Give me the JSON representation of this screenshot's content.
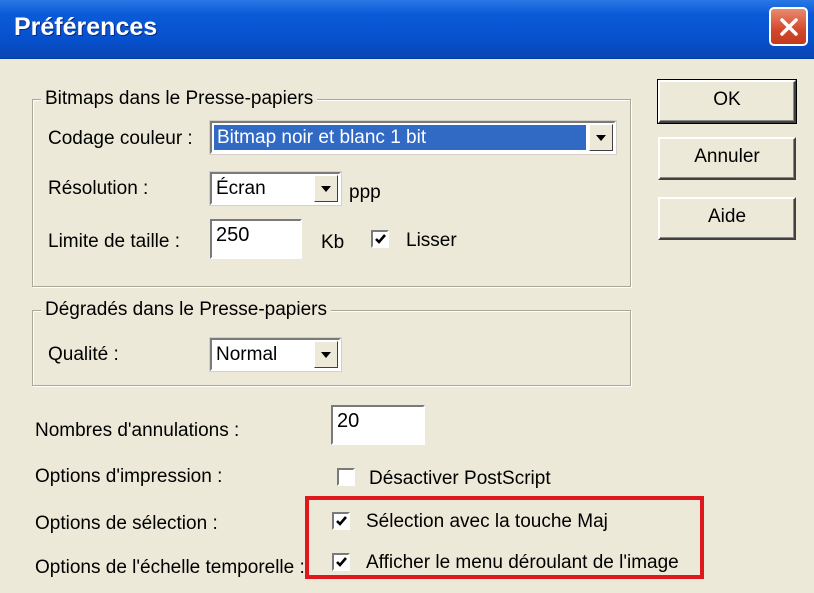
{
  "window": {
    "title": "Préférences"
  },
  "icons": {
    "close": "close-x-icon",
    "dropdown": "triangle-down-icon",
    "check": "checkmark-icon"
  },
  "colors": {
    "titlebar": "#0650cc",
    "selection": "#316ac5",
    "highlight_box": "#e0181e"
  },
  "buttons": {
    "ok": "OK",
    "cancel": "Annuler",
    "help": "Aide"
  },
  "bitmaps": {
    "legend": "Bitmaps dans le Presse-papiers",
    "color_label": "Codage couleur :",
    "color_value": "Bitmap noir et blanc 1 bit",
    "resolution_label": "Résolution :",
    "resolution_value": "Écran",
    "resolution_unit": "ppp",
    "size_label": "Limite de taille :",
    "size_value": "250",
    "size_unit": "Kb",
    "smooth_label": "Lisser",
    "smooth_checked": true
  },
  "gradients": {
    "legend": "Dégradés dans le Presse-papiers",
    "quality_label": "Qualité :",
    "quality_value": "Normal"
  },
  "undo": {
    "label": "Nombres d'annulations :",
    "value": "20"
  },
  "print": {
    "label": "Options d'impression :",
    "checkbox_label": "Désactiver PostScript",
    "checked": false
  },
  "selection": {
    "label": "Options de sélection :",
    "checkbox_label": "Sélection avec la touche Maj",
    "checked": true
  },
  "timeline": {
    "label": "Options de l'échelle temporelle :",
    "checkbox_label": "Afficher le menu déroulant de l'image",
    "checked": true
  }
}
